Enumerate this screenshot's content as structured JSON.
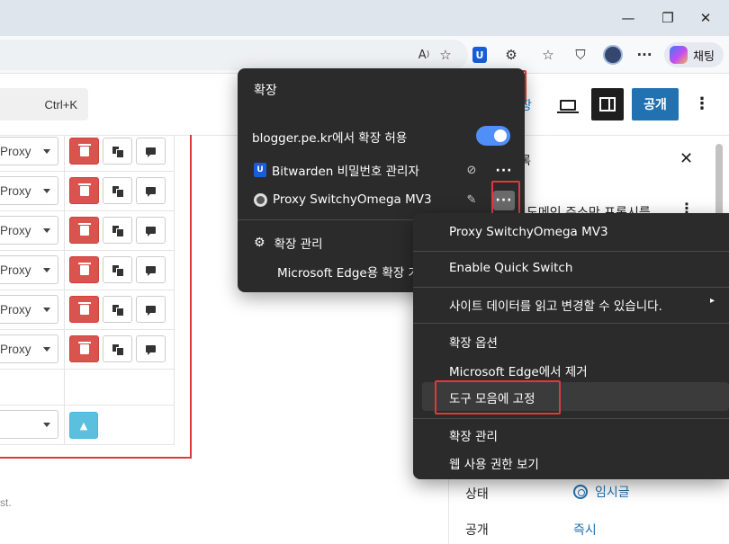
{
  "window": {
    "minimize_glyph": "—",
    "restore_glyph": "❐",
    "close_glyph": "✕"
  },
  "toolbar": {
    "read_aloud_label": "A",
    "favorites_glyph": "☆",
    "collections_glyph": "☆",
    "browser_essentials_glyph": "⛉",
    "more_glyph": "···",
    "chat_label": "채팅",
    "bitwarden_glyph": "U",
    "extensions_glyph": "⚙"
  },
  "page": {
    "search_shortcut": "Ctrl+K",
    "rows": [
      {
        "profile": "Proxy"
      },
      {
        "profile": "Proxy"
      },
      {
        "profile": "Proxy"
      },
      {
        "profile": "Proxy"
      },
      {
        "profile": "Proxy"
      },
      {
        "profile": "Proxy"
      }
    ],
    "up_glyph": "▲",
    "footnote": "st."
  },
  "blogger_panel": {
    "preview_link": "장",
    "publish_label": "공개",
    "kebab_glyph": "⋮",
    "tab_label": "록",
    "close_glyph": "✕",
    "post_title": "도메인 주소만 프록시를",
    "post_kebab": "⋮",
    "status_label": "상태",
    "status_value": "임시글",
    "visibility_label": "공개",
    "visibility_value": "즉시"
  },
  "extensions_popup": {
    "heading": "확장",
    "site_permission": "blogger.pe.kr에서 확장 허용",
    "site_permission_enabled": true,
    "items": [
      {
        "name": "Bitwarden 비밀번호 관리자",
        "pin_glyph": "⊘",
        "more_glyph": "···"
      },
      {
        "name": "Proxy SwitchyOmega MV3",
        "pin_glyph": "✎",
        "more_glyph": "···"
      }
    ],
    "manage_label": "확장 관리",
    "edge_store_label": "Microsoft Edge용 확장 가져오기"
  },
  "context_menu": {
    "title": "Proxy SwitchyOmega MV3",
    "quick_switch": "Enable Quick Switch",
    "site_data": "사이트 데이터를 읽고 변경할 수 있습니다.",
    "submenu_glyph": "▸",
    "options": "확장 옵션",
    "remove": "Microsoft Edge에서 제거",
    "pin_to_toolbar": "도구 모음에 고정",
    "manage": "확장 관리",
    "web_permissions": "웹 사용 권한 보기"
  },
  "colors": {
    "highlight": "#e0383b",
    "publish": "#2271b1",
    "danger": "#d9534f",
    "info": "#5bc0de",
    "popup_bg": "#2b2b2b"
  }
}
